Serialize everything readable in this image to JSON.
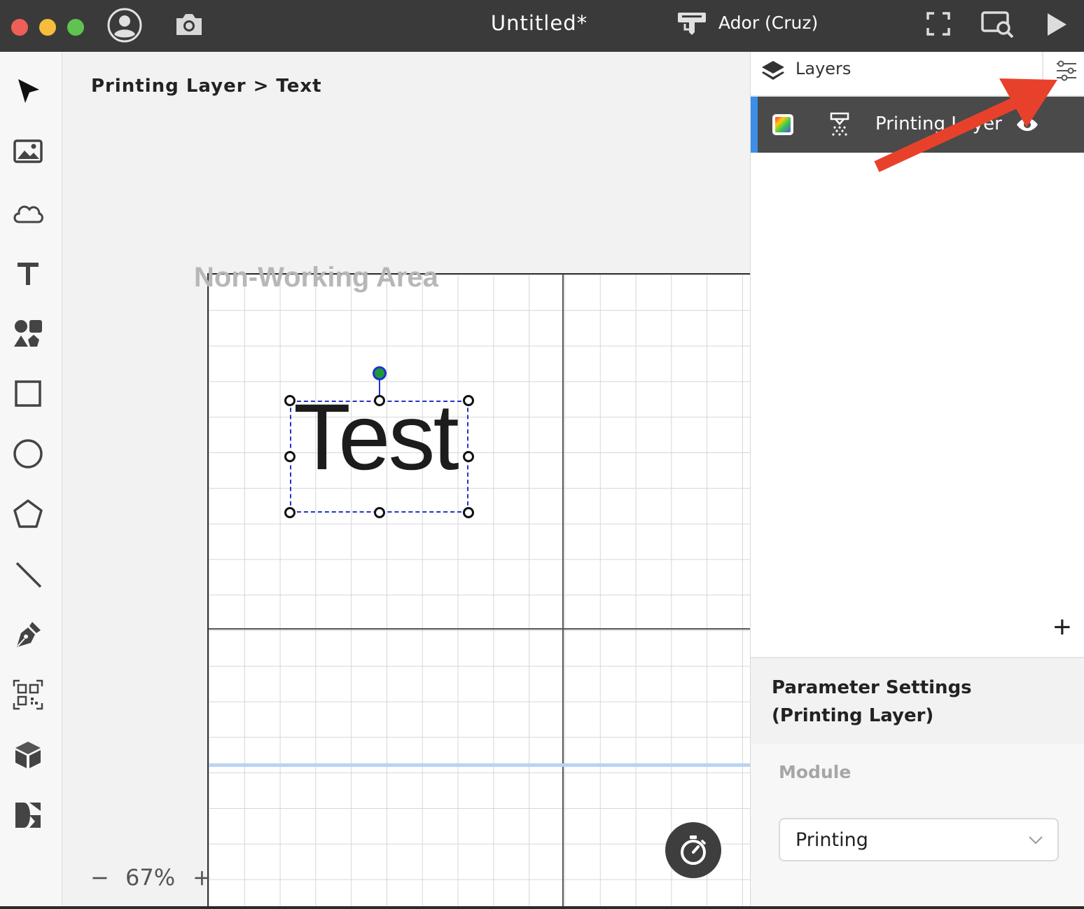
{
  "app": {
    "window_title": "Untitled*",
    "device_name": "Ador (Cruz)"
  },
  "workspace": {
    "breadcrumb": "Printing Layer > Text",
    "non_working_area_label": "Non-Working Area",
    "canvas_text": "Test",
    "zoom_minus": "−",
    "zoom_level": "67%",
    "zoom_plus": "+"
  },
  "layers_panel": {
    "title": "Layers",
    "layers": [
      {
        "name": "Printing Layer",
        "visible": true,
        "selected": true
      }
    ],
    "add_label": "+"
  },
  "parameter_settings": {
    "title": "Parameter Settings (Printing Layer)",
    "module_label": "Module",
    "module_value": "Printing"
  },
  "colors": {
    "titlebar": "#3a3a3a",
    "selected_layer_bg": "#4a4a4a",
    "layer_accent": "#3d8ee6",
    "annotation_arrow": "#e8412b",
    "selection_dash": "#2233cc"
  },
  "icons": {
    "titlebar": [
      "user-account-icon",
      "camera-icon",
      "device-icon",
      "frame-icon",
      "preview-icon",
      "play-icon"
    ],
    "toolbar": [
      "cursor-icon",
      "image-icon",
      "cloud-icon",
      "text-icon",
      "shapes-icon",
      "rectangle-icon",
      "ellipse-icon",
      "polygon-icon",
      "line-icon",
      "pen-icon",
      "qrcode-icon",
      "box-icon",
      "design-market-icon"
    ]
  }
}
